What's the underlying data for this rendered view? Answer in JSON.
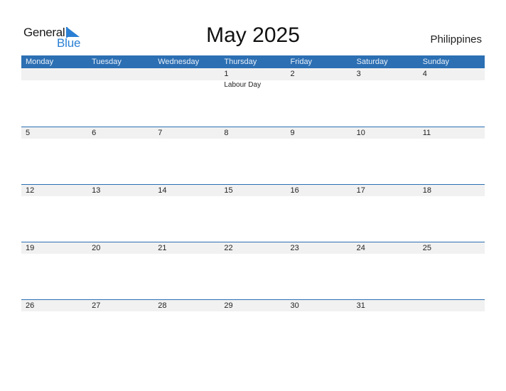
{
  "logo": {
    "word1": "General",
    "word2": "Blue",
    "accent_color": "#2a7fd4"
  },
  "title": "May 2025",
  "country": "Philippines",
  "colors": {
    "header_bg": "#2c6fb3",
    "date_strip_bg": "#f1f1f1"
  },
  "weekdays": [
    "Monday",
    "Tuesday",
    "Wednesday",
    "Thursday",
    "Friday",
    "Saturday",
    "Sunday"
  ],
  "weeks": [
    [
      {
        "day": ""
      },
      {
        "day": ""
      },
      {
        "day": ""
      },
      {
        "day": "1",
        "holiday": "Labour Day"
      },
      {
        "day": "2"
      },
      {
        "day": "3"
      },
      {
        "day": "4"
      }
    ],
    [
      {
        "day": "5"
      },
      {
        "day": "6"
      },
      {
        "day": "7"
      },
      {
        "day": "8"
      },
      {
        "day": "9"
      },
      {
        "day": "10"
      },
      {
        "day": "11"
      }
    ],
    [
      {
        "day": "12"
      },
      {
        "day": "13"
      },
      {
        "day": "14"
      },
      {
        "day": "15"
      },
      {
        "day": "16"
      },
      {
        "day": "17"
      },
      {
        "day": "18"
      }
    ],
    [
      {
        "day": "19"
      },
      {
        "day": "20"
      },
      {
        "day": "21"
      },
      {
        "day": "22"
      },
      {
        "day": "23"
      },
      {
        "day": "24"
      },
      {
        "day": "25"
      }
    ],
    [
      {
        "day": "26"
      },
      {
        "day": "27"
      },
      {
        "day": "28"
      },
      {
        "day": "29"
      },
      {
        "day": "30"
      },
      {
        "day": "31"
      },
      {
        "day": ""
      }
    ]
  ]
}
